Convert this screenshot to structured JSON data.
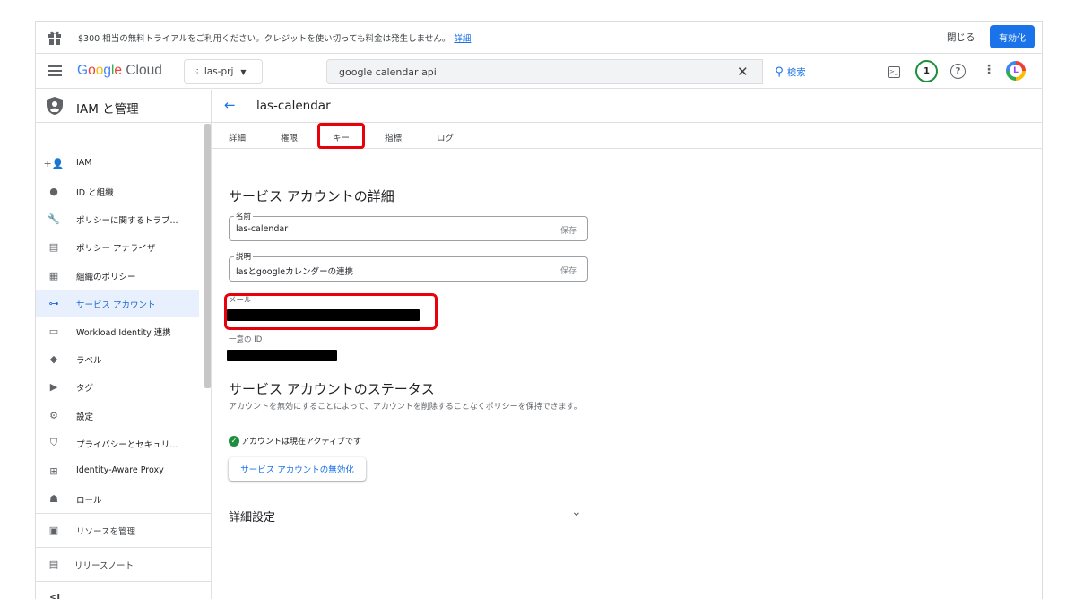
{
  "promo": {
    "message": "$300 相当の無料トライアルをご利用ください。クレジットを使い切っても料金は発生しません。",
    "details_link": "詳細",
    "close_label": "閉じる",
    "activate_label": "有効化"
  },
  "topbar": {
    "logo_g": "G",
    "logo_o1": "o",
    "logo_o2": "o",
    "logo_g2": "g",
    "logo_l": "l",
    "logo_e": "e",
    "logo_cloud": "Cloud",
    "project": "las-prj",
    "search_query": "google calendar api",
    "search_button": "検索",
    "notification_count": "1",
    "avatar_letter": "L",
    "icons": [
      "menu-icon",
      "terminal-icon",
      "help-icon",
      "more-vert-icon",
      "close-icon",
      "search-icon"
    ]
  },
  "sidebar": {
    "title": "IAM と管理",
    "items": [
      {
        "label": "IAM",
        "icon": "person-add-icon"
      },
      {
        "label": "ID と組織",
        "icon": "account-circle-icon"
      },
      {
        "label": "ポリシーに関するトラブ...",
        "icon": "wrench-icon"
      },
      {
        "label": "ポリシー アナライザ",
        "icon": "policy-analyzer-icon"
      },
      {
        "label": "組織のポリシー",
        "icon": "list-icon"
      },
      {
        "label": "サービス アカウント",
        "icon": "service-account-icon"
      },
      {
        "label": "Workload Identity 連携",
        "icon": "workload-icon"
      },
      {
        "label": "ラベル",
        "icon": "label-icon"
      },
      {
        "label": "タグ",
        "icon": "tag-icon"
      },
      {
        "label": "設定",
        "icon": "gear-icon"
      },
      {
        "label": "プライバシーとセキュリ...",
        "icon": "shield-icon"
      },
      {
        "label": "Identity-Aware Proxy",
        "icon": "proxy-icon"
      },
      {
        "label": "ロール",
        "icon": "roles-icon"
      }
    ],
    "manage_resources": "リソースを管理",
    "release_notes": "リリースノート",
    "collapse_label": "<I",
    "active_color": "#1967d2"
  },
  "main": {
    "account_name": "las-calendar",
    "tabs": [
      "詳細",
      "権限",
      "キー",
      "指標",
      "ログ"
    ],
    "details_heading": "サービス アカウントの詳細",
    "name_field": {
      "label": "名前",
      "value": "las-calendar",
      "save": "保存"
    },
    "desc_field": {
      "label": "説明",
      "value": "lasとgoogleカレンダーの連携",
      "save": "保存"
    },
    "email_label": "メール",
    "unique_id_label": "一意の ID",
    "status_heading": "サービス アカウントのステータス",
    "status_desc": "アカウントを無効にすることによって、アカウントを削除することなくポリシーを保持できます。",
    "status_active": "アカウントは現在アクティブです",
    "disable_button": "サービス アカウントの無効化",
    "advanced_settings": "詳細設定",
    "highlight_color": "#e8000b"
  }
}
